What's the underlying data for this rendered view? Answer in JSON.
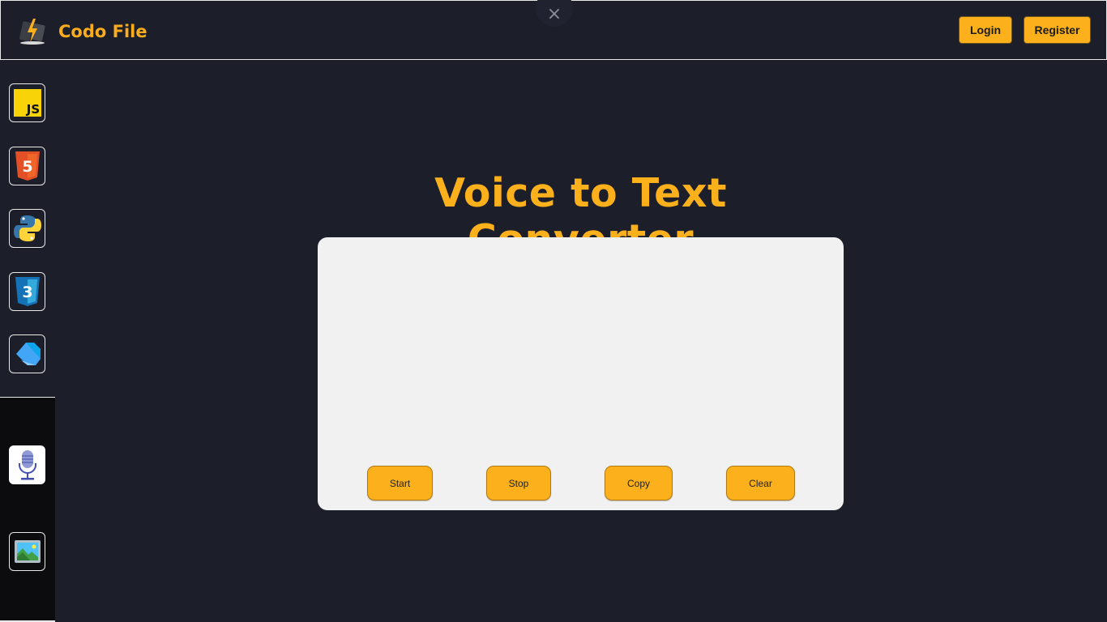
{
  "header": {
    "brand_name": "Codo File",
    "close_icon": "×",
    "login_label": "Login",
    "register_label": "Register"
  },
  "sidebar": {
    "items": [
      {
        "name": "javascript",
        "icon": "js-icon",
        "label": "JS"
      },
      {
        "name": "html5",
        "icon": "html5-icon",
        "label": "5"
      },
      {
        "name": "python",
        "icon": "python-icon"
      },
      {
        "name": "css3",
        "icon": "css3-icon",
        "label": "3"
      },
      {
        "name": "dart",
        "icon": "dart-icon"
      }
    ],
    "tools": [
      {
        "name": "voice-to-text",
        "icon": "microphone-icon"
      },
      {
        "name": "image",
        "icon": "image-icon"
      }
    ]
  },
  "main": {
    "title": "Voice to Text Converter",
    "output_text": "",
    "buttons": {
      "start": "Start",
      "stop": "Stop",
      "copy": "Copy",
      "clear": "Clear"
    }
  },
  "colors": {
    "accent": "#fbb01c",
    "background": "#1c1e29",
    "panel": "#f1f1f1"
  }
}
